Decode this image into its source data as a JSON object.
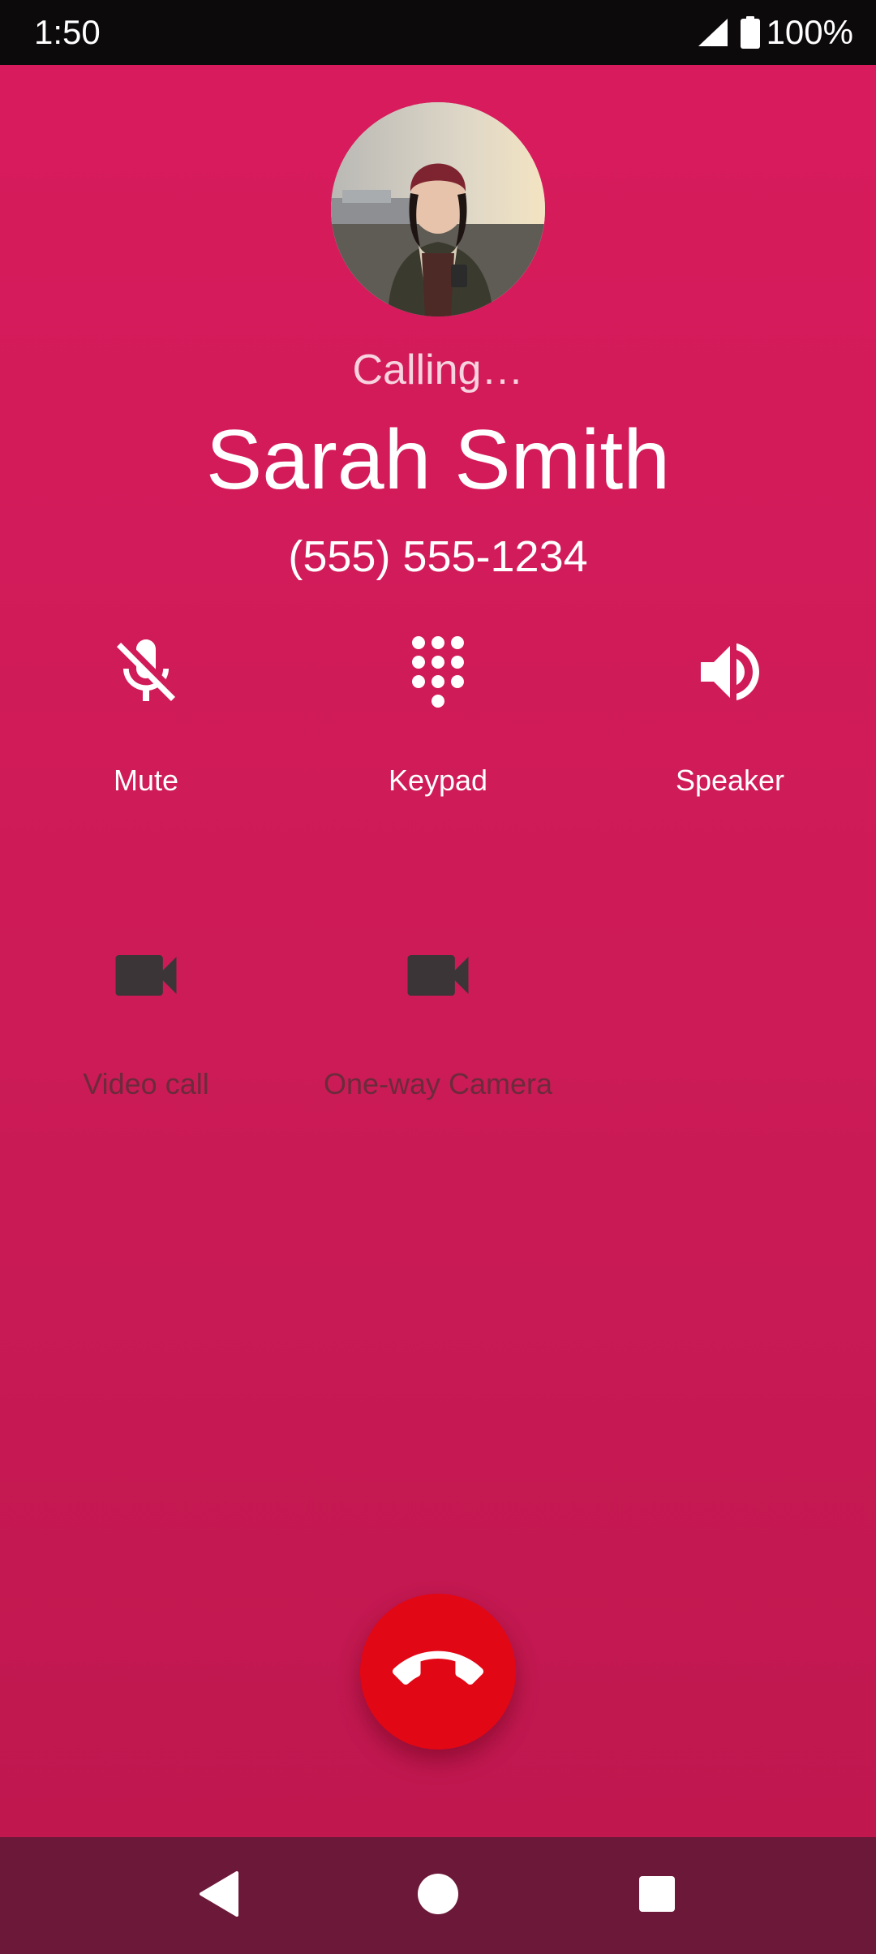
{
  "status_bar": {
    "time": "1:50",
    "battery": "100%",
    "icons": [
      "signal-icon",
      "battery-icon"
    ]
  },
  "call": {
    "status": "Calling…",
    "contact_name": "Sarah Smith",
    "phone_number": "(555) 555-1234"
  },
  "controls": {
    "mute": {
      "label": "Mute",
      "icon": "mic-off-icon",
      "enabled": true
    },
    "keypad": {
      "label": "Keypad",
      "icon": "dialpad-icon",
      "enabled": true
    },
    "speaker": {
      "label": "Speaker",
      "icon": "speaker-icon",
      "enabled": true
    },
    "video_call": {
      "label": "Video call",
      "icon": "videocam-icon",
      "enabled": false
    },
    "one_way_camera": {
      "label": "One-way Camera",
      "icon": "videocam-icon",
      "enabled": false
    }
  },
  "end_call": {
    "icon": "end-call-icon"
  },
  "nav_bar": {
    "icons": [
      "back-icon",
      "home-icon",
      "recents-icon"
    ]
  },
  "colors": {
    "background": "#d81b5c",
    "end_call": "#e20715",
    "nav_bar": "#6b1839",
    "disabled": "#6b2b3c"
  }
}
